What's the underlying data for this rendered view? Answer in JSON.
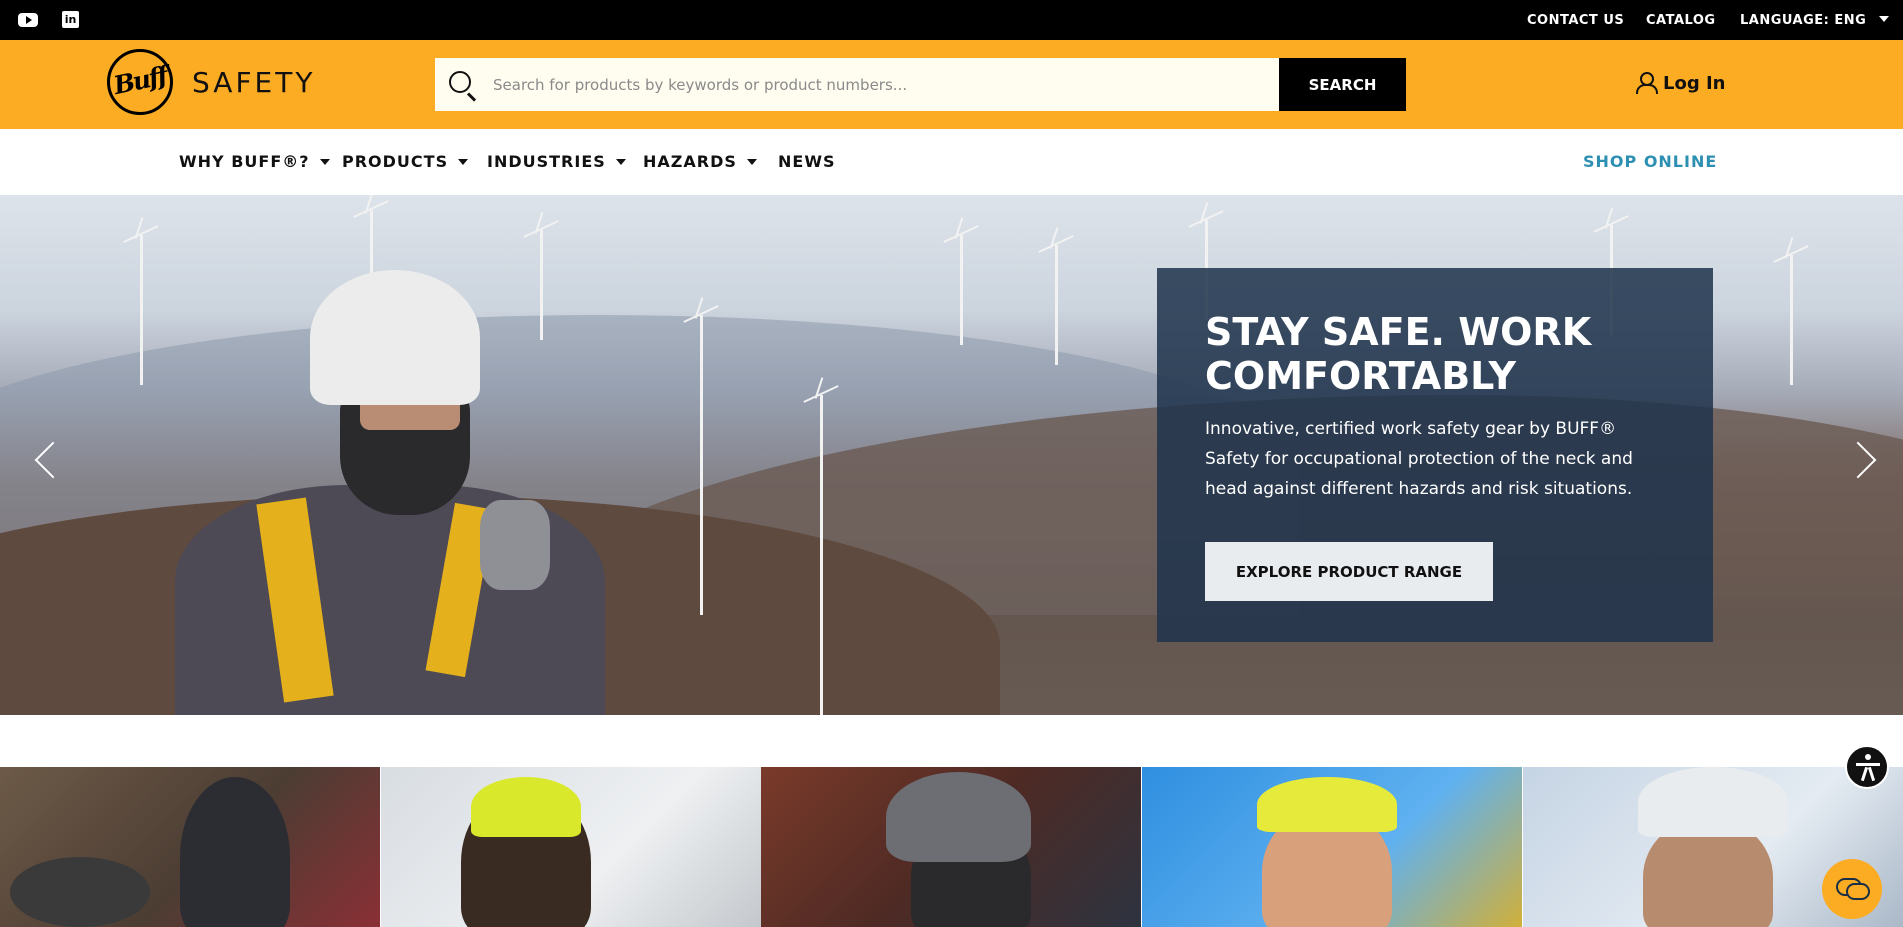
{
  "topbar": {
    "social_icons": [
      "youtube-icon",
      "linkedin-icon"
    ],
    "linkedin_glyph": "in",
    "contact_label": "CONTACT US",
    "catalog_label": "CATALOG",
    "language_label": "LANGUAGE:",
    "language_value": "ENG"
  },
  "header": {
    "logo_mark": "Buff",
    "logo_text": "SAFETY",
    "search_placeholder": "Search for products by keywords or product numbers...",
    "search_button": "SEARCH",
    "login_label": "Log In",
    "accent_color": "#fcac23"
  },
  "nav": {
    "items": [
      {
        "label": "WHY BUFF®?",
        "dropdown": true
      },
      {
        "label": "PRODUCTS",
        "dropdown": true
      },
      {
        "label": "INDUSTRIES",
        "dropdown": true
      },
      {
        "label": "HAZARDS",
        "dropdown": true
      },
      {
        "label": "NEWS",
        "dropdown": false
      }
    ],
    "shop_online": "SHOP ONLINE",
    "shop_color": "#2d90b2"
  },
  "hero": {
    "title": "STAY SAFE. WORK COMFORTABLY",
    "text": "Innovative, certified work safety gear by BUFF® Safety for occupational protection of the neck and head against different hazards and risk situations.",
    "cta": "EXPLORE PRODUCT RANGE",
    "card_color": "#1f334c"
  },
  "tiles": {
    "count": 5
  },
  "widgets": {
    "accessibility": "accessibility-icon",
    "chat": "chat-icon"
  }
}
